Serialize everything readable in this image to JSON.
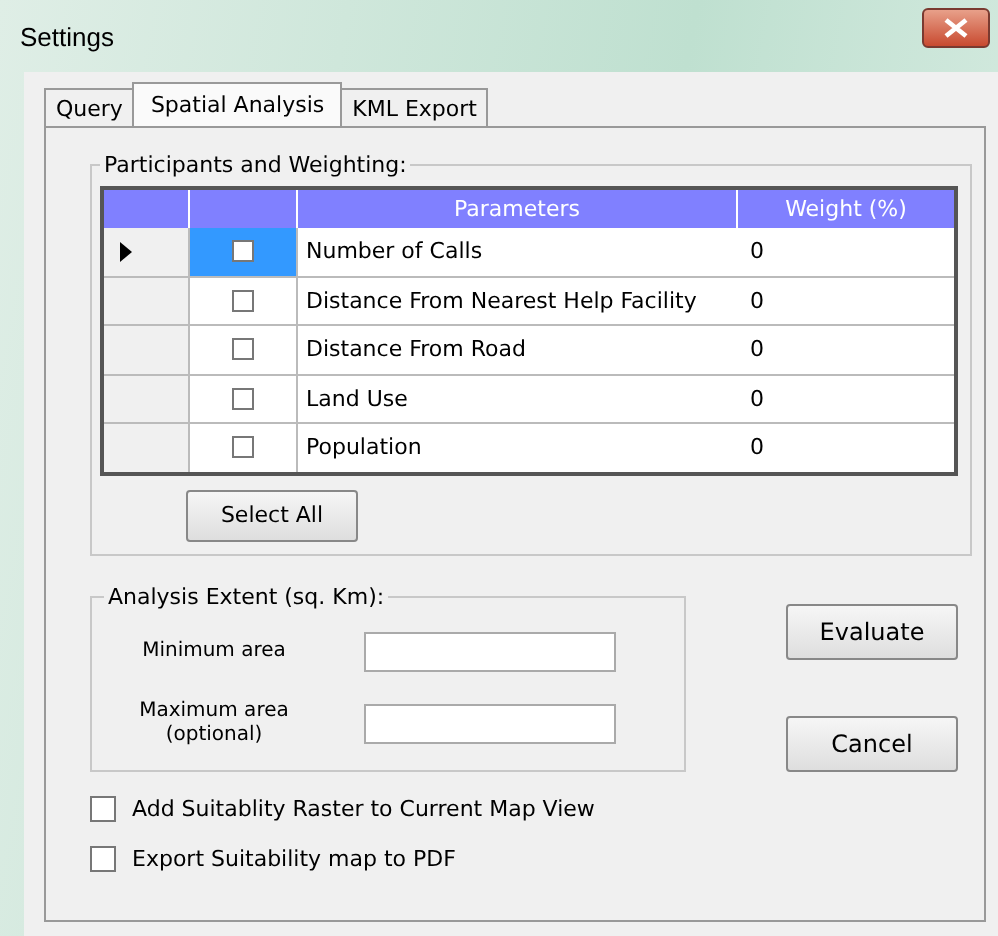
{
  "window": {
    "title": "Settings"
  },
  "tabs": [
    {
      "label": "Query",
      "selected": false
    },
    {
      "label": "Spatial Analysis",
      "selected": true
    },
    {
      "label": "KML Export",
      "selected": false
    }
  ],
  "participants": {
    "title": "Participants and Weighting:",
    "columns": [
      "Parameters",
      "Weight (%)"
    ],
    "rows": [
      {
        "parameter": "Number of Calls",
        "weight": "0",
        "checked": false,
        "selected": true
      },
      {
        "parameter": "Distance From Nearest Help Facility",
        "weight": "0",
        "checked": false,
        "selected": false
      },
      {
        "parameter": "Distance From Road",
        "weight": "0",
        "checked": false,
        "selected": false
      },
      {
        "parameter": "Land Use",
        "weight": "0",
        "checked": false,
        "selected": false
      },
      {
        "parameter": "Population",
        "weight": "0",
        "checked": false,
        "selected": false
      }
    ],
    "select_all": "Select All"
  },
  "extent": {
    "title": "Analysis Extent (sq. Km):",
    "fields": [
      {
        "label": "Minimum area"
      },
      {
        "label": "Maximum area\n(optional)"
      }
    ]
  },
  "buttons": [
    "Evaluate",
    "Cancel"
  ],
  "options": [
    {
      "label": "Add Suitablity Raster to Current Map View",
      "checked": false
    },
    {
      "label": "Export Suitability map to PDF",
      "checked": false
    }
  ]
}
